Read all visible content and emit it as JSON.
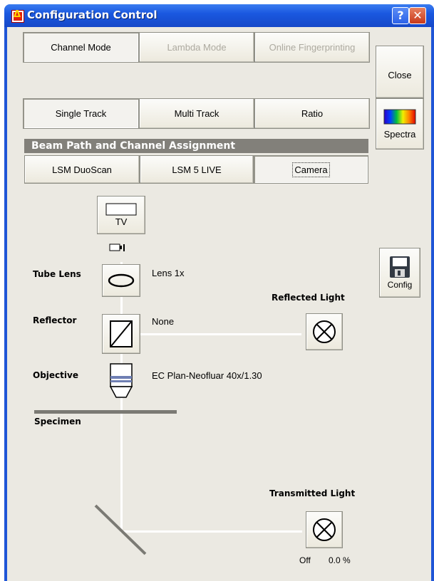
{
  "window": {
    "title": "Configuration Control",
    "help_glyph": "?",
    "close_glyph": "✕"
  },
  "mode_tabs": [
    {
      "label": "Channel Mode",
      "state": "selected"
    },
    {
      "label": "Lambda Mode",
      "state": "disabled"
    },
    {
      "label": "Online Fingerprinting",
      "state": "disabled"
    }
  ],
  "track_tabs": [
    {
      "label": "Single Track",
      "state": "selected"
    },
    {
      "label": "Multi Track",
      "state": "normal"
    },
    {
      "label": "Ratio",
      "state": "normal"
    }
  ],
  "side": {
    "close_label": "Close",
    "spectra_label": "Spectra",
    "config_label": "Config"
  },
  "beam_path": {
    "heading": "Beam Path and Channel Assignment",
    "tabs": [
      {
        "label": "LSM DuoScan",
        "state": "normal"
      },
      {
        "label": "LSM 5 LIVE",
        "state": "normal"
      },
      {
        "label": "Camera",
        "state": "selected"
      }
    ],
    "tv_label": "TV",
    "tube_lens": {
      "label": "Tube Lens",
      "value": "Lens 1x"
    },
    "reflector": {
      "label": "Reflector",
      "value": "None"
    },
    "objective": {
      "label": "Objective",
      "value": "EC Plan-Neofluar 40x/1.30"
    },
    "specimen_label": "Specimen",
    "reflected_light_label": "Reflected Light",
    "transmitted_light": {
      "label": "Transmitted Light",
      "status": "Off",
      "intensity": "0.0 %"
    }
  },
  "colors": {
    "titlebar": "#1a58e0",
    "panel": "#ebe9e2",
    "heading_bg": "#82807a",
    "beam": "#ffffff",
    "close_button": "#c8391a"
  }
}
